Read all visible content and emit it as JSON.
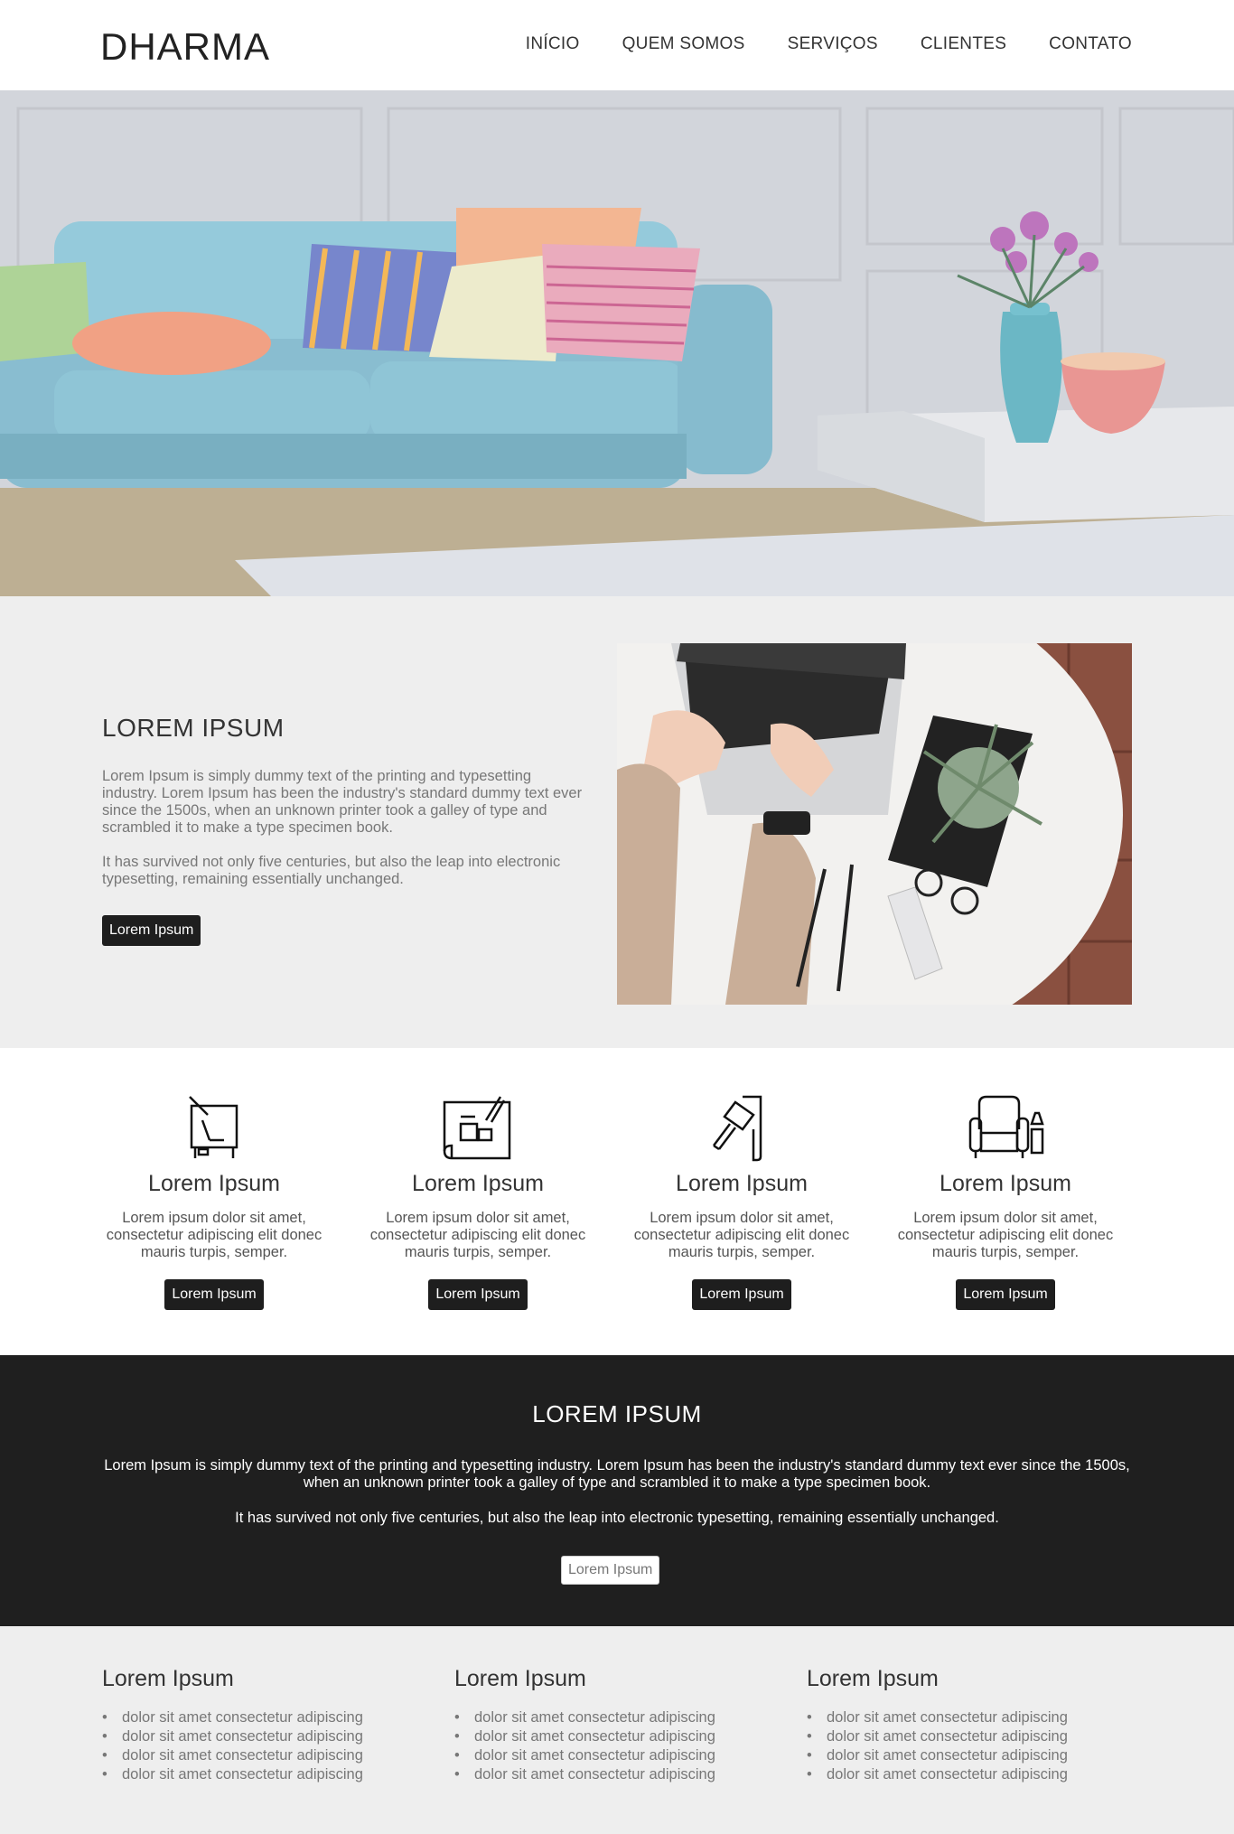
{
  "header": {
    "logo": "DHARMA",
    "nav": [
      "INÍCIO",
      "QUEM SOMOS",
      "SERVIÇOS",
      "CLIENTES",
      "CONTATO"
    ]
  },
  "about": {
    "title": "LOREM IPSUM",
    "paragraph1": "Lorem Ipsum is simply dummy text of the printing and typesetting industry. Lorem Ipsum has been the industry's standard dummy text ever since the 1500s, when an unknown printer took a galley of type and scrambled it to make a type specimen book.",
    "paragraph2": "It has survived not only five centuries, but also the leap into electronic typesetting, remaining essentially unchanged.",
    "button": "Lorem Ipsum"
  },
  "services": [
    {
      "icon": "drawing-board-icon",
      "title": "Lorem Ipsum",
      "text": "Lorem ipsum dolor sit amet, consectetur adipiscing elit donec mauris turpis, semper.",
      "button": "Lorem Ipsum"
    },
    {
      "icon": "blueprint-icon",
      "title": "Lorem Ipsum",
      "text": "Lorem ipsum dolor sit amet, consectetur adipiscing elit donec mauris turpis, semper.",
      "button": "Lorem Ipsum"
    },
    {
      "icon": "paint-brush-icon",
      "title": "Lorem Ipsum",
      "text": "Lorem ipsum dolor sit amet, consectetur adipiscing elit donec mauris turpis, semper.",
      "button": "Lorem Ipsum"
    },
    {
      "icon": "armchair-icon",
      "title": "Lorem Ipsum",
      "text": "Lorem ipsum dolor sit amet, consectetur adipiscing elit donec mauris turpis, semper.",
      "button": "Lorem Ipsum"
    }
  ],
  "band": {
    "title": "LOREM IPSUM",
    "paragraph1": "Lorem Ipsum is simply dummy text of the printing and typesetting industry. Lorem Ipsum has been the industry's standard dummy text ever since the 1500s, when an unknown printer took a galley of type and scrambled it to make a type specimen book.",
    "paragraph2": "It has survived not only five centuries, but also the leap into electronic typesetting, remaining essentially unchanged.",
    "button": "Lorem Ipsum"
  },
  "footer": {
    "columns": [
      {
        "title": "Lorem Ipsum",
        "items": [
          "dolor sit amet consectetur adipiscing",
          "dolor sit amet consectetur adipiscing",
          "dolor sit amet consectetur adipiscing",
          "dolor sit amet consectetur adipiscing"
        ]
      },
      {
        "title": "Lorem Ipsum",
        "items": [
          "dolor sit amet consectetur adipiscing",
          "dolor sit amet consectetur adipiscing",
          "dolor sit amet consectetur adipiscing",
          "dolor sit amet consectetur adipiscing"
        ]
      },
      {
        "title": "Lorem Ipsum",
        "items": [
          "dolor sit amet consectetur adipiscing",
          "dolor sit amet consectetur adipiscing",
          "dolor sit amet consectetur adipiscing",
          "dolor sit amet consectetur adipiscing"
        ]
      }
    ]
  },
  "colors": {
    "dark": "#1f1f1f",
    "light_bg": "#eeeeee",
    "text": "#333333"
  }
}
